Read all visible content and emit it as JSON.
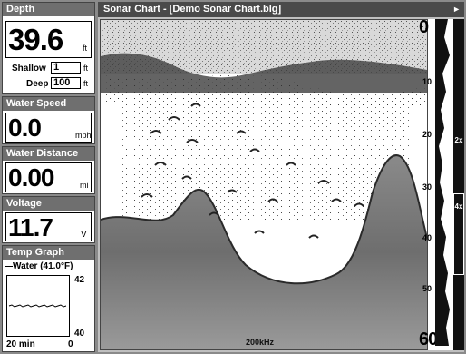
{
  "sidebar": {
    "depth": {
      "title": "Depth",
      "value": "39.6",
      "unit": "ft",
      "shallow_label": "Shallow",
      "shallow_value": "1",
      "shallow_unit": "ft",
      "deep_label": "Deep",
      "deep_value": "100",
      "deep_unit": "ft"
    },
    "water_speed": {
      "title": "Water Speed",
      "value": "0.0",
      "unit": "mph"
    },
    "water_distance": {
      "title": "Water Distance",
      "value": "0.00",
      "unit": "mi"
    },
    "voltage": {
      "title": "Voltage",
      "value": "11.7",
      "unit": "V"
    },
    "temp_graph": {
      "title": "Temp Graph",
      "legend": "Water (41.0°F)",
      "y_top": "42",
      "y_bottom": "40",
      "x_left": "20 min",
      "x_right": "0"
    }
  },
  "main": {
    "title": "Sonar Chart - [Demo Sonar Chart.blg]",
    "frequency": "200kHz",
    "depth_scale": {
      "top": "0",
      "ticks": [
        "10",
        "20",
        "30",
        "40",
        "50"
      ],
      "bottom": "60"
    },
    "zoom_labels": [
      "2x",
      "4x"
    ]
  },
  "colors": {
    "panel_header": "#6f6f6f",
    "title_bar": "#4a4a4a",
    "sonar_bottom": "#6e6e6e"
  },
  "icons": {
    "title_arrow": "right-arrow-icon"
  }
}
